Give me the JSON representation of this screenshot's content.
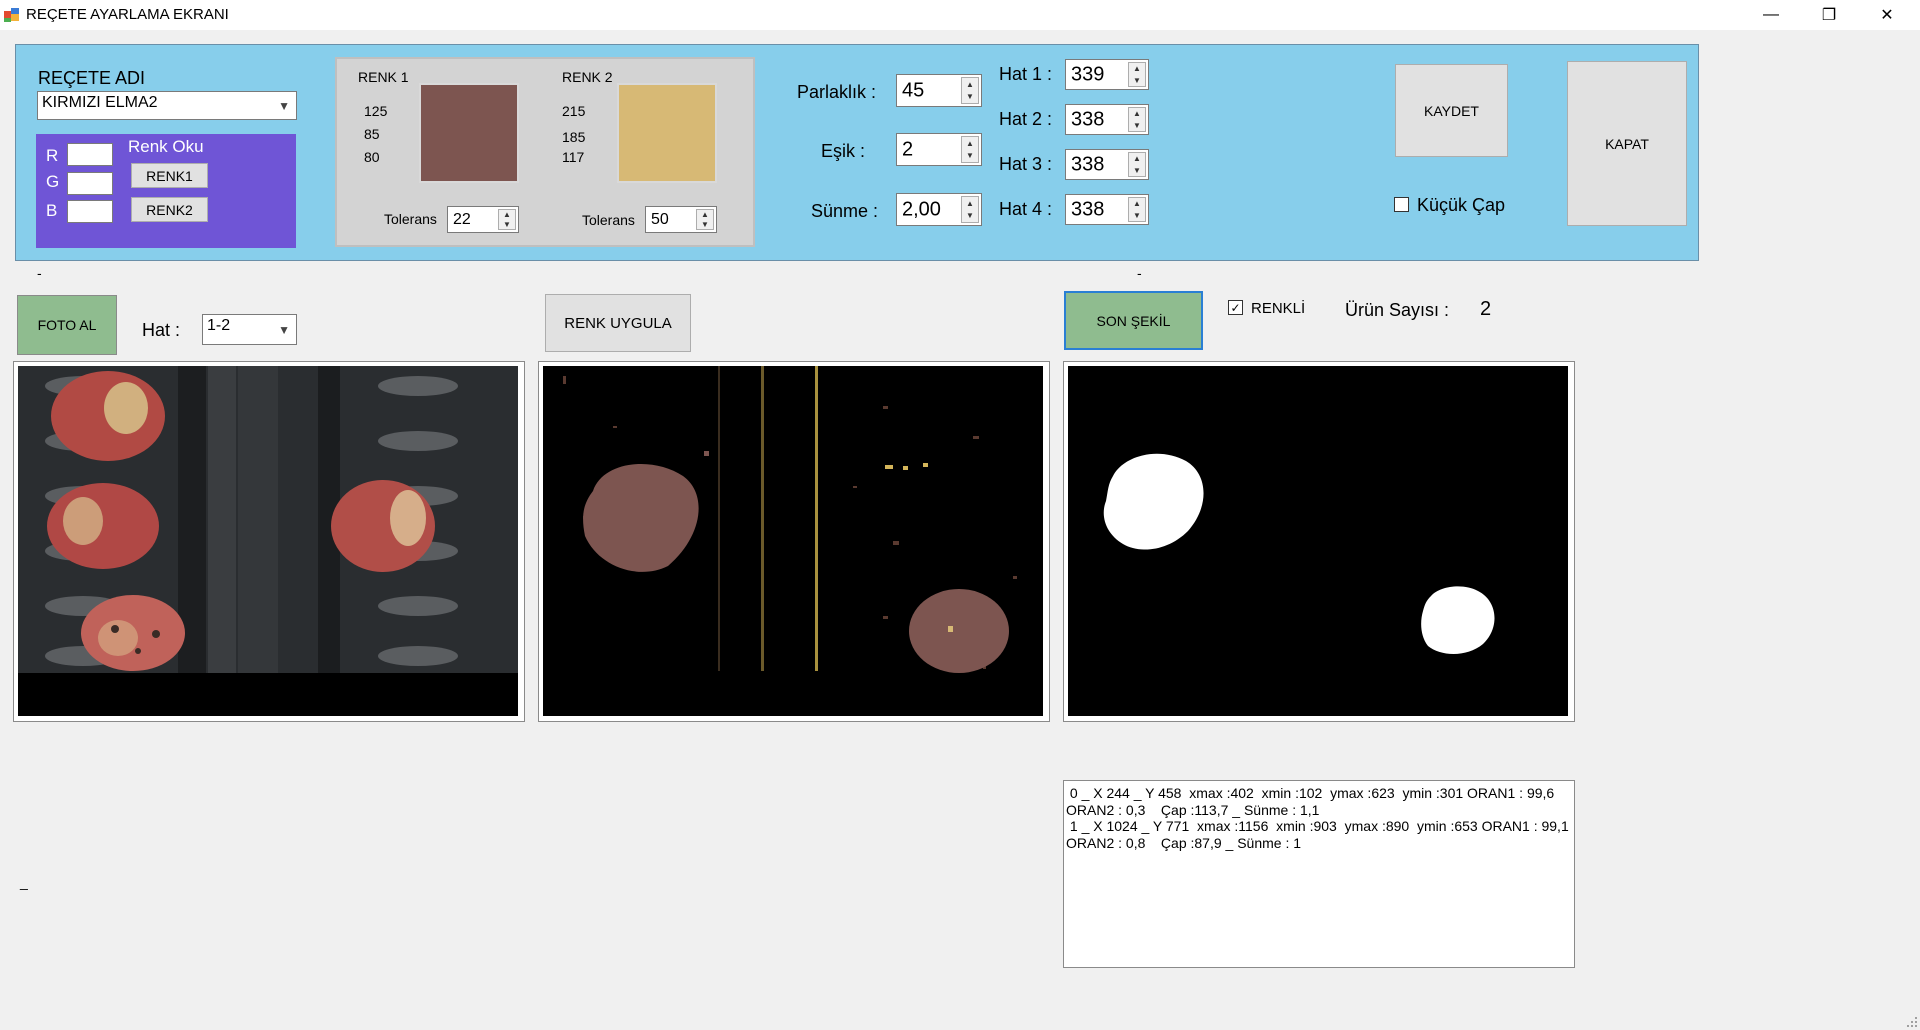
{
  "window": {
    "title": "REÇETE AYARLAMA EKRANI",
    "minimize": "—",
    "maximize": "❐",
    "close": "✕"
  },
  "recipe": {
    "label": "REÇETE ADI",
    "selected": "KIRMIZI ELMA2"
  },
  "color_reader": {
    "title": "Renk Oku",
    "r_label": "R",
    "g_label": "G",
    "b_label": "B",
    "r_value": "",
    "g_value": "",
    "b_value": "",
    "renk1_button": "RENK1",
    "renk2_button": "RENK2"
  },
  "colors": {
    "renk1": {
      "label": "RENK 1",
      "r": "125",
      "g": "85",
      "b": "80",
      "hex": "#7d5550",
      "tolerance_label": "Tolerans",
      "tolerance": "22"
    },
    "renk2": {
      "label": "RENK 2",
      "r": "215",
      "g": "185",
      "b": "117",
      "hex": "#d7b975",
      "tolerance_label": "Tolerans",
      "tolerance": "50"
    }
  },
  "settings": {
    "parlaklik_label": "Parlaklık :",
    "parlaklik": "45",
    "esik_label": "Eşik :",
    "esik": "2",
    "sunme_label": "Sünme :",
    "sunme": "2,00"
  },
  "lines": [
    {
      "label": "Hat 1 :",
      "value": "339"
    },
    {
      "label": "Hat 2 :",
      "value": "338"
    },
    {
      "label": "Hat 3 :",
      "value": "338"
    },
    {
      "label": "Hat 4 :",
      "value": "338"
    }
  ],
  "buttons": {
    "kaydet": "KAYDET",
    "kapat": "KAPAT",
    "foto_al": "FOTO AL",
    "renk_uygula": "RENK UYGULA",
    "son_sekil": "SON ŞEKİL"
  },
  "small_diameter": {
    "label": "Küçük Çap",
    "checked": false
  },
  "hat_selector": {
    "label": "Hat :",
    "selected": "1-2"
  },
  "colored": {
    "label": "RENKLİ",
    "checked": true
  },
  "product_count": {
    "label": "Ürün Sayısı :",
    "value": "2"
  },
  "markers": {
    "dash1": "-",
    "dash2": "-",
    "dash3": "_"
  },
  "results_text": " 0 _ X 244 _ Y 458  xmax :402  xmin :102  ymax :623  ymin :301 ORAN1 : 99,6\nORAN2 : 0,3    Çap :113,7 _ Sünme : 1,1\n 1 _ X 1024 _ Y 771  xmax :1156  xmin :903  ymax :890  ymin :653 ORAN1 : 99,1\nORAN2 : 0,8    Çap :87,9 _ Sünme : 1",
  "icons": {
    "app": "app-icon",
    "dropdown": "chevron-down-icon",
    "spin_up": "spin-up-icon",
    "spin_down": "spin-down-icon",
    "check": "check-icon"
  }
}
